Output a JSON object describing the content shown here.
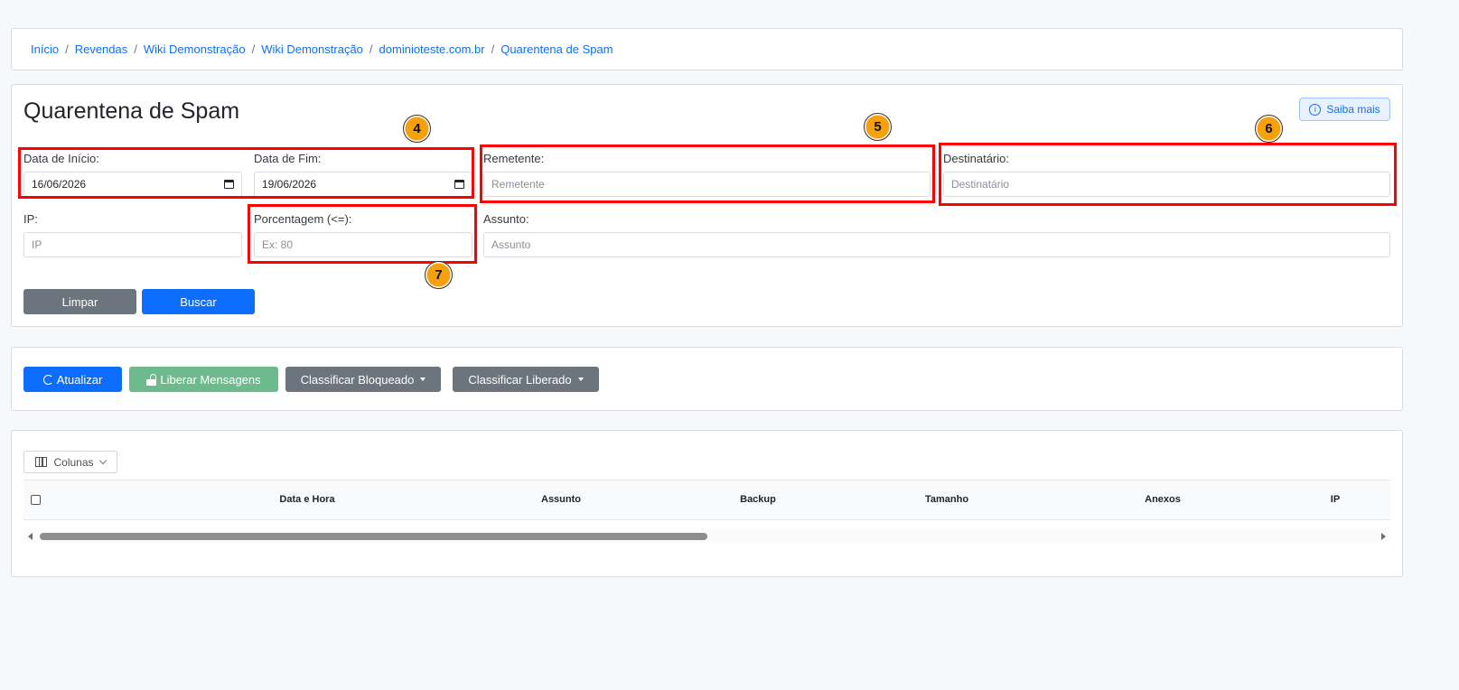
{
  "breadcrumb": [
    "Início",
    "Revendas",
    "Wiki Demonstração",
    "Wiki Demonstração",
    "dominioteste.com.br",
    "Quarentena de Spam"
  ],
  "page": {
    "title": "Quarentena de Spam",
    "saiba_mais": "Saiba mais"
  },
  "filters": {
    "data_inicio_label": "Data de Início:",
    "data_inicio_value": "16/06/2026",
    "data_fim_label": "Data de Fim:",
    "data_fim_value": "19/06/2026",
    "remetente_label": "Remetente:",
    "remetente_placeholder": "Remetente",
    "destinatario_label": "Destinatário:",
    "destinatario_placeholder": "Destinatário",
    "ip_label": "IP:",
    "ip_placeholder": "IP",
    "porcentagem_label": "Porcentagem (<=):",
    "porcentagem_placeholder": "Ex: 80",
    "assunto_label": "Assunto:",
    "assunto_placeholder": "Assunto",
    "limpar": "Limpar",
    "buscar": "Buscar"
  },
  "actions": {
    "atualizar": "Atualizar",
    "liberar": "Liberar Mensagens",
    "classificar_bloqueado": "Classificar Bloqueado",
    "classificar_liberado": "Classificar Liberado"
  },
  "table": {
    "colunas_button": "Colunas",
    "headers": [
      "Data e Hora",
      "Assunto",
      "Backup",
      "Tamanho",
      "Anexos",
      "IP"
    ]
  },
  "annotations": [
    "4",
    "5",
    "6",
    "7"
  ],
  "colors": {
    "primary": "#0d6efd",
    "secondary": "#6c757d",
    "success": "#6dbb8d",
    "highlight": "#ff0000",
    "badge": "#f5a00d"
  }
}
